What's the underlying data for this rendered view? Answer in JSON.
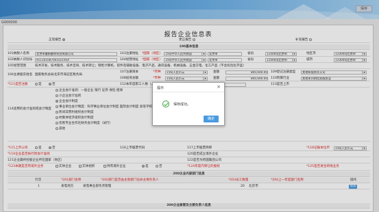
{
  "header": {
    "save_label": "保存"
  },
  "code": "G000000",
  "report": {
    "title": "报告企业信息表",
    "report_type": [
      {
        "label": "正常报告",
        "selected": true
      },
      {
        "label": "更正报告",
        "selected": false
      },
      {
        "label": "补充报告",
        "selected": false
      }
    ],
    "section_basic": "100基本信息"
  },
  "rows": {
    "r101": {
      "label": "101纳税人名称",
      "value": "北京市睿新麒祥科技有限公司",
      "addr_label": "103注册地址",
      "addr_prov": "*国家（地区）",
      "addr_prov_val": "156|中华人民共和国",
      "addr_city_val": "北京市",
      "sub_label1": "省份",
      "sub_val1": "110000|北京市",
      "sub_label2": "地区市",
      "sub_val2": "110000|北京市"
    },
    "r102": {
      "label": "102纳税人识别号",
      "value": "91110108700102195X",
      "addr_label": "104经营地址",
      "addr_prov": "*国家（地区）",
      "addr_prov_val": "156|中华人民共和国",
      "addr_city_val": "北京市",
      "sub_label1": "省份",
      "sub_val1": "110000|北京市",
      "sub_label2": "城市",
      "sub_val2": "110000|北京市"
    },
    "r105": {
      "label": "105经营范围",
      "value": "技术开发、技术服务、技术咨询、技术转让；销售计算机、软件及辅助设备、电子产品、通讯设备、机械设备、五金交电、化工产品（不含危险化学品）"
    },
    "r106": {
      "label": "106主要股东姓名",
      "value": "国家税务总局北京市海淀区税务局",
      "cap_label": "107注册资本",
      "cap_prov": "*币种",
      "cap_val": "156|人民币元",
      "amt_label": "金额",
      "amt_val": "800,000.00",
      "rate_label": "109登记注册类型",
      "rate_val": "其他有限责任公司"
    },
    "r108": {
      "cap_label": "108投资总额",
      "cap_prov": "*币种",
      "cap_val": "156|人民币元",
      "amt_label": "金额",
      "amt_val": "800,000.00",
      "rate_label": "110所属行业",
      "rate_val": "其他未列明信息服务业"
    },
    "r111": {
      "label": "*111是否注册",
      "yes": "是",
      "no": "否",
      "cnt_label": "112本年度职工人数（人）",
      "emp_label": "113是否上市"
    }
  },
  "accounting": {
    "side_label": "114适用的会计准则或会计制度",
    "lines": [
      "企业会计准则：一般企业  银行  证券  保险  担保",
      "小企业会计准则",
      "企业会计制度",
      "事业单位会计制度：科学事业单位会计制度  医院会计制度  高等学校会计制度  中小学校会计制度  彩票机构会计制度",
      "民间非营利组织会计制度",
      "村集体经济组织会计制度",
      "农民专业合作社财务会计制度（试行）",
      "其他"
    ]
  },
  "lower": {
    "r115": {
      "label": "*115上市公司",
      "yes": "是",
      "no": "否",
      "l116": "116上市股票代码",
      "l117": "117上市股票简称",
      "l118": "*118记账本位币",
      "v118": "156|人民币元"
    },
    "r119": {
      "label": "*119企业是否执行新会计准则",
      "l120": "120是否成立境外企业"
    },
    "r121": {
      "label": "121企业最终控股企业所在国家（地区）",
      "l122": "122是否为跨国集团公司"
    },
    "r123": {
      "label": "*123本期是否有境外业务",
      "opt1": "实体企业",
      "opt2": "实体组织",
      "opt3": "持有境外企业",
      "yes": "是",
      "no": "否",
      "l124": "*124年度内转让的股权",
      "l125": "*125是否发生跨境业务"
    },
    "section_200": "200企业内部部门信息",
    "table_headers": [
      "行次",
      "*201部门名称",
      "*202部门是否由主管部门任命主要负责人",
      "*203员工数量",
      "*204上一年度部门名称",
      "操作"
    ],
    "table_row": {
      "idx": "1",
      "name": "发电地方",
      "desc": "发电事业部负责管理",
      "count": "20",
      "prev": "北京市",
      "action": "增加"
    },
    "section_300": "300企业高管及主要负责人信息"
  },
  "dialog": {
    "title": "提示",
    "close": "×",
    "message": "保存成功。",
    "ok_label": "确定"
  }
}
